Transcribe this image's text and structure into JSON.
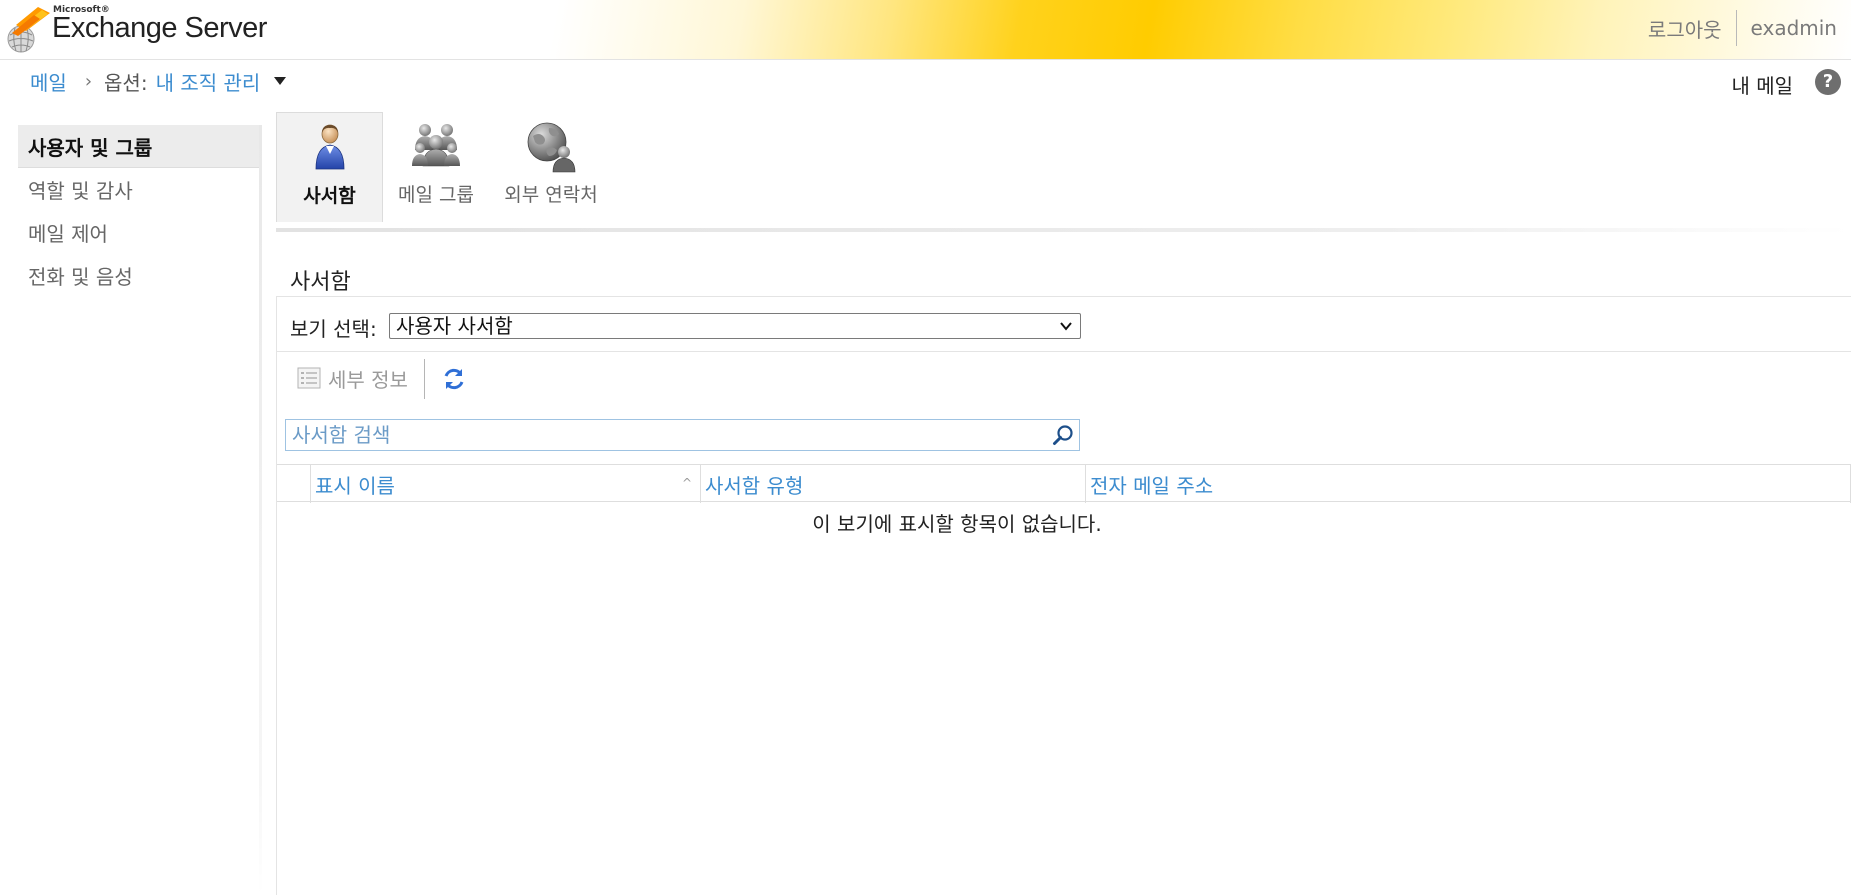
{
  "header": {
    "brand_small": "Microsoft®",
    "brand_name": "Exchange Server",
    "logout_label": "로그아웃",
    "user_name": "exadmin"
  },
  "breadcrumb": {
    "mail_link": "메일",
    "options_label": "옵션:",
    "manage_link": "내 조직 관리"
  },
  "utility": {
    "my_mail": "내 메일",
    "help": "?"
  },
  "sidebar": {
    "items": [
      {
        "label": "사용자 및 그룹",
        "active": true
      },
      {
        "label": "역할 및 감사",
        "active": false
      },
      {
        "label": "메일 제어",
        "active": false
      },
      {
        "label": "전화 및 음성",
        "active": false
      }
    ]
  },
  "ribbon": {
    "items": [
      {
        "label": "사서함",
        "icon": "user-icon",
        "active": true
      },
      {
        "label": "메일 그룹",
        "icon": "group-icon",
        "active": false
      },
      {
        "label": "외부 연락처",
        "icon": "globe-contact-icon",
        "active": false
      }
    ]
  },
  "main": {
    "section_title": "사서함",
    "view_label": "보기 선택:",
    "view_selected": "사용자 사서함",
    "toolbar": {
      "details_label": "세부 정보",
      "refresh_icon": "refresh-icon"
    },
    "search": {
      "placeholder": "사서함 검색"
    },
    "grid": {
      "columns": [
        "표시 이름",
        "사서함 유형",
        "전자 메일 주소"
      ],
      "sort_indicator": "^",
      "empty_message": "이 보기에 표시할 항목이 없습니다."
    }
  },
  "colors": {
    "link_blue": "#3c8ccf",
    "header_yellow": "#ffcc00",
    "active_nav_bg": "#ececec"
  }
}
